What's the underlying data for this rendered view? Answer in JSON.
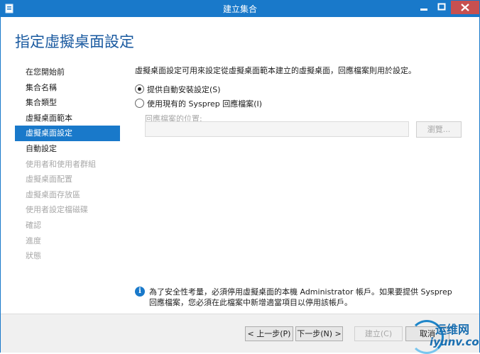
{
  "window": {
    "title": "建立集合",
    "icon": "server-manager-icon",
    "controls": [
      "minimize-icon",
      "maximize-icon",
      "close-icon"
    ]
  },
  "header": {
    "title": "指定虛擬桌面設定"
  },
  "nav": {
    "items": [
      {
        "label": "在您開始前",
        "state": "normal"
      },
      {
        "label": "集合名稱",
        "state": "normal"
      },
      {
        "label": "集合類型",
        "state": "normal"
      },
      {
        "label": "虛擬桌面範本",
        "state": "normal"
      },
      {
        "label": "虛擬桌面設定",
        "state": "selected"
      },
      {
        "label": "自動設定",
        "state": "normal"
      },
      {
        "label": "使用者和使用者群組",
        "state": "disabled"
      },
      {
        "label": "虛擬桌面配置",
        "state": "disabled"
      },
      {
        "label": "虛擬桌面存放區",
        "state": "disabled"
      },
      {
        "label": "使用者設定檔磁碟",
        "state": "disabled"
      },
      {
        "label": "確認",
        "state": "disabled"
      },
      {
        "label": "進度",
        "state": "disabled"
      },
      {
        "label": "狀態",
        "state": "disabled"
      }
    ]
  },
  "main": {
    "description": "虛擬桌面設定可用來設定從虛擬桌面範本建立的虛擬桌面，回應檔案則用於設定。",
    "options": [
      {
        "label": "提供自動安裝設定(S)",
        "checked": true
      },
      {
        "label": "使用現有的 Sysprep 回應檔案(I)",
        "checked": false
      }
    ],
    "answer_file": {
      "label": "回應檔案的位置:",
      "value": "",
      "browse_label": "瀏覽..."
    }
  },
  "info": {
    "icon": "info-icon",
    "glyph": "i",
    "text": "為了安全性考量，必須停用虛擬桌面的本機 Administrator 帳戶。如果要提供 Sysprep 回應檔案，您必須在此檔案中新增適當項目以停用該帳戶。"
  },
  "footer": {
    "prev_label": "< 上一步(P)",
    "next_label": "下一步(N) >",
    "create_label": "建立(C)",
    "cancel_label": "取消"
  },
  "watermark": {
    "cn": "运维网",
    "en": "iyunv.com"
  },
  "colors": {
    "accent": "#1979ca",
    "title_text": "#1a5aa0",
    "disabled": "#a8a8a8"
  }
}
